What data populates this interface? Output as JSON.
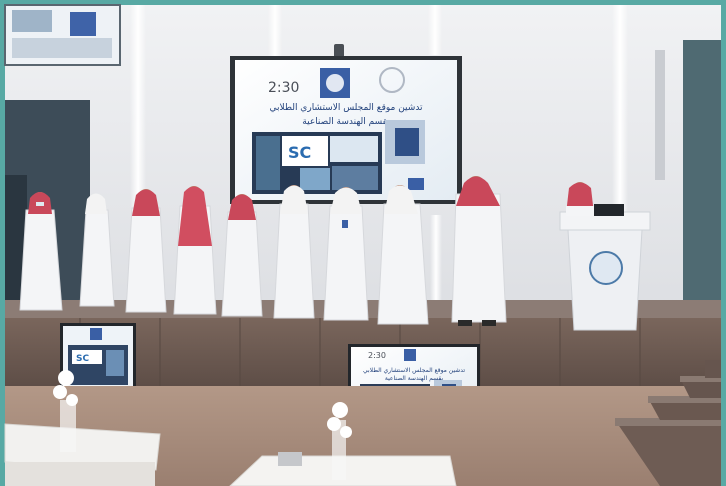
{
  "photo": {
    "frame_color": "#58a9a4",
    "wall_color": "#e9ebee",
    "stage_color": "#6f5d55",
    "floor_color": "#a88d7e"
  },
  "main_screen": {
    "clock": "2:30",
    "title_line1": "تدشين موقع المجلس الاستشاري الطلابي",
    "title_line2": "بقسم الهندسة الصناعية",
    "logo_text": "SC"
  },
  "stage_monitor_right": {
    "clock": "2:30",
    "title_line1": "تدشين موقع المجلس الاستشاري الطلابي",
    "title_line2": "بقسم الهندسة الصناعية",
    "logo_text": "SC"
  },
  "stage_monitor_left": {
    "logo_text": "SC"
  },
  "people_count": 11
}
